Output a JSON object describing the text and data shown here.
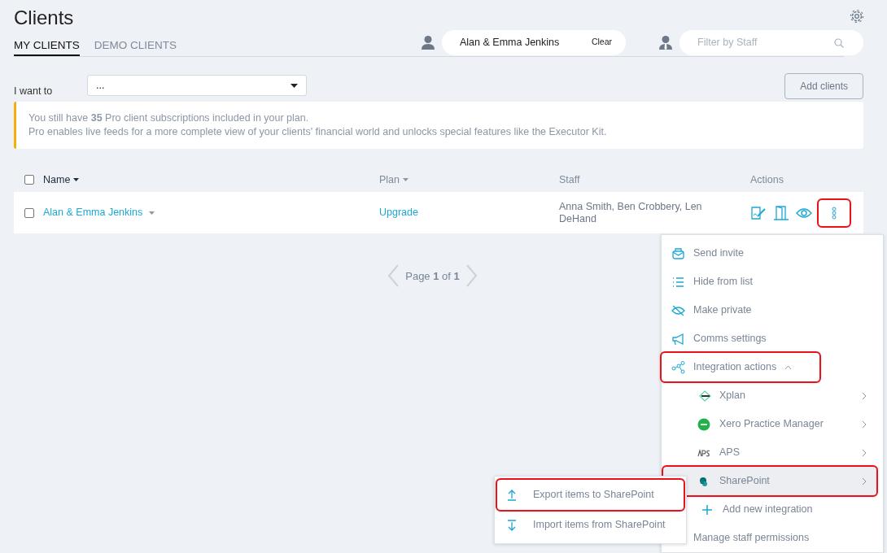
{
  "page": {
    "title": "Clients"
  },
  "tabs": [
    {
      "label": "MY CLIENTS",
      "selected": true
    },
    {
      "label": "DEMO CLIENTS",
      "selected": false
    }
  ],
  "client_filter": {
    "value": "Alan & Emma Jenkins",
    "clear": "Clear"
  },
  "staff_filter": {
    "placeholder": "Filter by Staff"
  },
  "action_select": {
    "label": "I want to",
    "value": "..."
  },
  "add_button": "Add clients",
  "notice": {
    "lines": [
      "You still have **35** Pro client subscriptions included in your plan.",
      "Pro enables live feeds for a more complete view of your clients' financial world and unlocks special features like the Executor Kit."
    ]
  },
  "table": {
    "all_checked": false,
    "columns": [
      {
        "label": "Name",
        "kind": "check",
        "sortable": true,
        "sorted": true
      },
      {
        "label": "Plan",
        "kind": "text",
        "sortable": true,
        "sorted": false
      },
      {
        "label": "Staff",
        "kind": "text",
        "sortable": false,
        "sorted": false
      },
      {
        "label": "Actions",
        "kind": "text",
        "sortable": false,
        "sorted": false
      }
    ],
    "rows": [
      {
        "name": "Alan & Emma Jenkins",
        "checked": false,
        "plan": "Upgrade",
        "staff": "Anna Smith, Ben Crobbery, Len DeHand",
        "more_highlighted": true
      }
    ]
  },
  "pagination": {
    "text": "Page **1** of **1**"
  },
  "menu": {
    "items": [
      {
        "kind": "action",
        "label": "Send invite",
        "highlighted": false
      },
      {
        "kind": "action",
        "label": "Hide from list",
        "highlighted": false
      },
      {
        "kind": "action",
        "label": "Make private",
        "highlighted": false
      },
      {
        "kind": "action",
        "label": "Comms settings",
        "highlighted": false
      },
      {
        "kind": "group",
        "label": "Integration actions",
        "highlighted": true,
        "expanded": true,
        "children": [
          {
            "kind": "integration",
            "label": "Xplan",
            "selected": false,
            "highlighted": false
          },
          {
            "kind": "integration",
            "label": "Xero Practice Manager",
            "selected": false,
            "highlighted": false
          },
          {
            "kind": "integration",
            "label": "APS",
            "selected": false,
            "highlighted": false
          },
          {
            "kind": "integration",
            "label": "SharePoint",
            "selected": true,
            "highlighted": true
          },
          {
            "kind": "add",
            "label": "Add new integration",
            "selected": false,
            "highlighted": false
          }
        ]
      },
      {
        "kind": "action",
        "label": "Manage staff permissions",
        "highlighted": false
      }
    ]
  },
  "submenu": {
    "items": [
      {
        "kind": "export",
        "label": "Export items to SharePoint",
        "highlighted": true
      },
      {
        "kind": "import",
        "label": "Import items from SharePoint",
        "highlighted": false
      }
    ]
  }
}
